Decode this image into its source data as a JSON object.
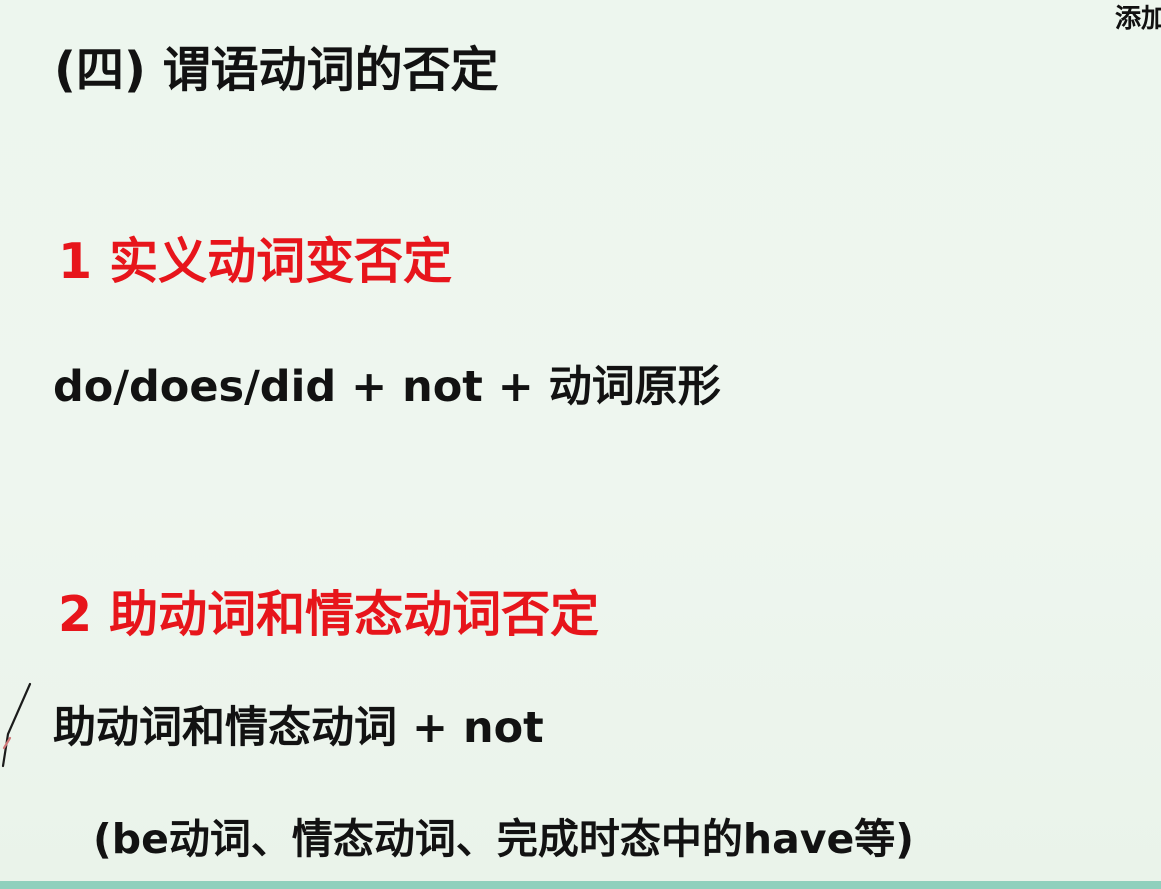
{
  "slide": {
    "corner_text": "添加",
    "title": "(四) 谓语动词的否定",
    "section1": {
      "heading": "1 实义动词变否定",
      "formula": "do/does/did + not + 动词原形"
    },
    "section2": {
      "heading": "2 助动词和情态动词否定",
      "formula": "助动词和情态动词 + not",
      "note": "(be动词、情态动词、完成时态中的have等)"
    }
  },
  "colors": {
    "background": "#eef6ef",
    "heading": "#e7151b",
    "text": "#121212",
    "bottom_bar": "#8fd0bd"
  }
}
